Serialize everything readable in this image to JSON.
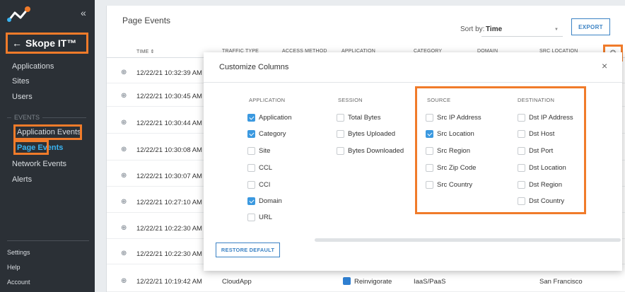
{
  "sidebar": {
    "collapse_glyph": "«",
    "app_title": "Skope IT™",
    "back_glyph": "←",
    "top_items": [
      {
        "label": "Applications"
      },
      {
        "label": "Sites"
      },
      {
        "label": "Users"
      }
    ],
    "section_label": "EVENTS",
    "event_items": [
      {
        "label": "Application Events",
        "active": false
      },
      {
        "label": "Page Events",
        "active": true
      },
      {
        "label": "Network Events",
        "active": false
      },
      {
        "label": "Alerts",
        "active": false
      }
    ],
    "bottom_items": [
      {
        "label": "Settings"
      },
      {
        "label": "Help"
      },
      {
        "label": "Account"
      }
    ]
  },
  "main": {
    "title": "Page Events",
    "sort_label": "Sort by:",
    "sort_value": "Time",
    "export_label": "EXPORT",
    "columns": [
      {
        "label": "TIME ⇕"
      },
      {
        "label": "TRAFFIC TYPE"
      },
      {
        "label": "ACCESS METHOD"
      },
      {
        "label": "APPLICATION"
      },
      {
        "label": "CATEGORY"
      },
      {
        "label": "DOMAIN"
      },
      {
        "label": "SRC LOCATION"
      }
    ],
    "rows": [
      {
        "time": "12/22/21 10:32:39 AM"
      },
      {
        "time": "12/22/21 10:30:45 AM"
      },
      {
        "time": "12/22/21 10:30:44 AM"
      },
      {
        "time": "12/22/21 10:30:08 AM"
      },
      {
        "time": "12/22/21 10:30:07 AM"
      },
      {
        "time": "12/22/21 10:27:10 AM"
      },
      {
        "time": "12/22/21 10:22:30 AM"
      },
      {
        "time": "12/22/21 10:22:30 AM"
      },
      {
        "time": "12/22/21 10:19:42 AM",
        "traffic_type": "CloudApp",
        "application": "Reinvigorate",
        "category": "IaaS/PaaS",
        "src_location": "San Francisco"
      }
    ]
  },
  "modal": {
    "title": "Customize Columns",
    "close_glyph": "×",
    "restore_label": "RESTORE DEFAULT",
    "groups": [
      {
        "heading": "APPLICATION",
        "options": [
          {
            "label": "Application",
            "checked": true
          },
          {
            "label": "Category",
            "checked": true
          },
          {
            "label": "Site",
            "checked": false
          },
          {
            "label": "CCL",
            "checked": false
          },
          {
            "label": "CCI",
            "checked": false
          },
          {
            "label": "Domain",
            "checked": true
          },
          {
            "label": "URL",
            "checked": false
          }
        ]
      },
      {
        "heading": "SESSION",
        "options": [
          {
            "label": "Total Bytes",
            "checked": false
          },
          {
            "label": "Bytes Uploaded",
            "checked": false
          },
          {
            "label": "Bytes Downloaded",
            "checked": false
          }
        ]
      },
      {
        "heading": "SOURCE",
        "options": [
          {
            "label": "Src IP Address",
            "checked": false
          },
          {
            "label": "Src Location",
            "checked": true
          },
          {
            "label": "Src Region",
            "checked": false
          },
          {
            "label": "Src Zip Code",
            "checked": false
          },
          {
            "label": "Src Country",
            "checked": false
          }
        ]
      },
      {
        "heading": "DESTINATION",
        "options": [
          {
            "label": "Dst IP Address",
            "checked": false
          },
          {
            "label": "Dst Host",
            "checked": false
          },
          {
            "label": "Dst Port",
            "checked": false
          },
          {
            "label": "Dst Location",
            "checked": false
          },
          {
            "label": "Dst Region",
            "checked": false
          },
          {
            "label": "Dst Country",
            "checked": false
          }
        ]
      }
    ]
  },
  "colors": {
    "sidebar_bg": "#2b3036",
    "highlight": "#f07b2a",
    "accent_blue": "#3b82c4",
    "active_nav": "#3ab4f2",
    "checkbox_on": "#3b99e0"
  }
}
